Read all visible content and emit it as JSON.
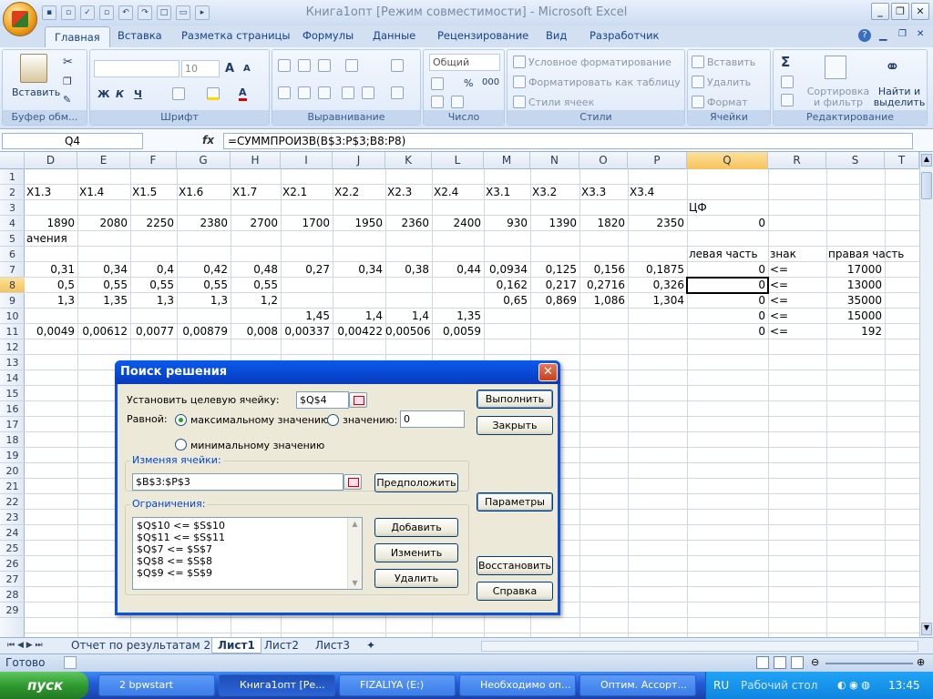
{
  "window": {
    "title": "Книга1опт  [Режим совместимости] - Microsoft Excel",
    "btn_min": "_",
    "btn_max": "❐",
    "btn_close": "✕"
  },
  "ribbon": {
    "tabs": [
      "Главная",
      "Вставка",
      "Разметка страницы",
      "Формулы",
      "Данные",
      "Рецензирование",
      "Вид",
      "Разработчик"
    ],
    "active_tab": "Главная",
    "help_icon": "?",
    "clipboard": {
      "paste": "Вставить",
      "label": "Буфер обм..."
    },
    "font": {
      "name": "",
      "size": "10",
      "bold": "Ж",
      "italic": "К",
      "underline": "Ч",
      "grow": "A",
      "shrink": "A",
      "color": "A",
      "label": "Шрифт"
    },
    "align": {
      "label": "Выравнивание"
    },
    "number": {
      "format": "Общий",
      "percent": "%",
      "thousands": "000",
      "label": "Число"
    },
    "styles": {
      "cond": "Условное форматирование",
      "table": "Форматировать как таблицу",
      "cell": "Стили ячеек",
      "label": "Стили"
    },
    "cells": {
      "insert": "Вставить",
      "delete": "Удалить",
      "format": "Формат",
      "label": "Ячейки"
    },
    "editing": {
      "sum": "Σ",
      "sort": "Сортировка и фильтр",
      "find": "Найти и выделить",
      "label": "Редактирование"
    }
  },
  "formula_bar": {
    "namebox": "Q4",
    "fx": "fx",
    "formula": "=СУММПРОИЗВ(B$3:P$3;B8:P8)"
  },
  "columns": [
    "D",
    "E",
    "F",
    "G",
    "H",
    "I",
    "J",
    "K",
    "L",
    "M",
    "N",
    "O",
    "P",
    "Q",
    "R",
    "S",
    "T"
  ],
  "active_column": "Q",
  "active_row": "8",
  "rows": [
    "1",
    "2",
    "3",
    "4",
    "5",
    "6",
    "7",
    "8",
    "9",
    "10",
    "11",
    "12",
    "13",
    "14",
    "15",
    "16",
    "17",
    "18",
    "19",
    "20",
    "21",
    "22",
    "23",
    "24",
    "25",
    "26",
    "27",
    "28",
    "29"
  ],
  "cells": {
    "r2": [
      "X1.3",
      "X1.4",
      "X1.5",
      "X1.6",
      "X1.7",
      "X2.1",
      "X2.2",
      "X2.3",
      "X2.4",
      "X3.1",
      "X3.2",
      "X3.3",
      "X3.4"
    ],
    "r3_q": "ЦФ",
    "r4": [
      "1890",
      "2080",
      "2250",
      "2380",
      "2700",
      "1700",
      "1950",
      "2360",
      "2400",
      "930",
      "1390",
      "1820",
      "2350",
      "0"
    ],
    "r5_a": "ачения",
    "r6": {
      "q": "левая часть",
      "r": "знак",
      "s": "правая часть"
    },
    "r7": [
      "0,31",
      "0,34",
      "0,4",
      "0,42",
      "0,48",
      "0,27",
      "0,34",
      "0,38",
      "0,44",
      "0,0934",
      "0,125",
      "0,156",
      "0,1875",
      "0",
      "<=",
      "17000"
    ],
    "r8": [
      "0,5",
      "0,55",
      "0,55",
      "0,55",
      "0,55",
      "0,162",
      "0,217",
      "0,2716",
      "0,326",
      "0",
      "<=",
      "13000"
    ],
    "r9": [
      "1,3",
      "1,35",
      "1,3",
      "1,3",
      "1,2",
      "0,65",
      "0,869",
      "1,086",
      "1,304",
      "0",
      "<=",
      "35000"
    ],
    "r10": [
      "1,45",
      "1,4",
      "1,4",
      "1,35",
      "0",
      "<=",
      "15000"
    ],
    "r11": [
      "0,0049",
      "0,00612",
      "0,0077",
      "0,00879",
      "0,008",
      "0,00337",
      "0,00422",
      "0,00506",
      "0,0059",
      "0",
      "<=",
      "192"
    ]
  },
  "sheets": {
    "tabs": [
      "Отчет по результатам 2",
      "Лист1",
      "Лист2",
      "Лист3"
    ],
    "active": "Лист1"
  },
  "status": {
    "ready": "Готово"
  },
  "solver": {
    "title": "Поиск решения",
    "target_label": "Установить целевую ячейку:",
    "target": "$Q$4",
    "equal_label": "Равной:",
    "opt_max": "максимальному значению",
    "opt_value": "значению:",
    "value": "0",
    "opt_min": "минимальному значению",
    "changing_label": "Изменяя ячейки:",
    "changing": "$B$3:$P$3",
    "constraints_label": "Ограничения:",
    "constraints": [
      "$Q$10 <= $S$10",
      "$Q$11 <= $S$11",
      "$Q$7 <= $S$7",
      "$Q$8 <= $S$8",
      "$Q$9 <= $S$9"
    ],
    "btn_run": "Выполнить",
    "btn_close": "Закрыть",
    "btn_guess": "Предположить",
    "btn_options": "Параметры",
    "btn_add": "Добавить",
    "btn_change": "Изменить",
    "btn_delete": "Удалить",
    "btn_reset": "Восстановить",
    "btn_help": "Справка"
  },
  "taskbar": {
    "start": "пуск",
    "buttons": [
      "2 bpwstart",
      "Книга1опт [Ре...",
      "FIZALIYA (E:)",
      "Необходимо оп...",
      "Оптим. Ассорт..."
    ],
    "lang": "RU",
    "desktop": "Рабочий стол",
    "clock": "13:45"
  }
}
